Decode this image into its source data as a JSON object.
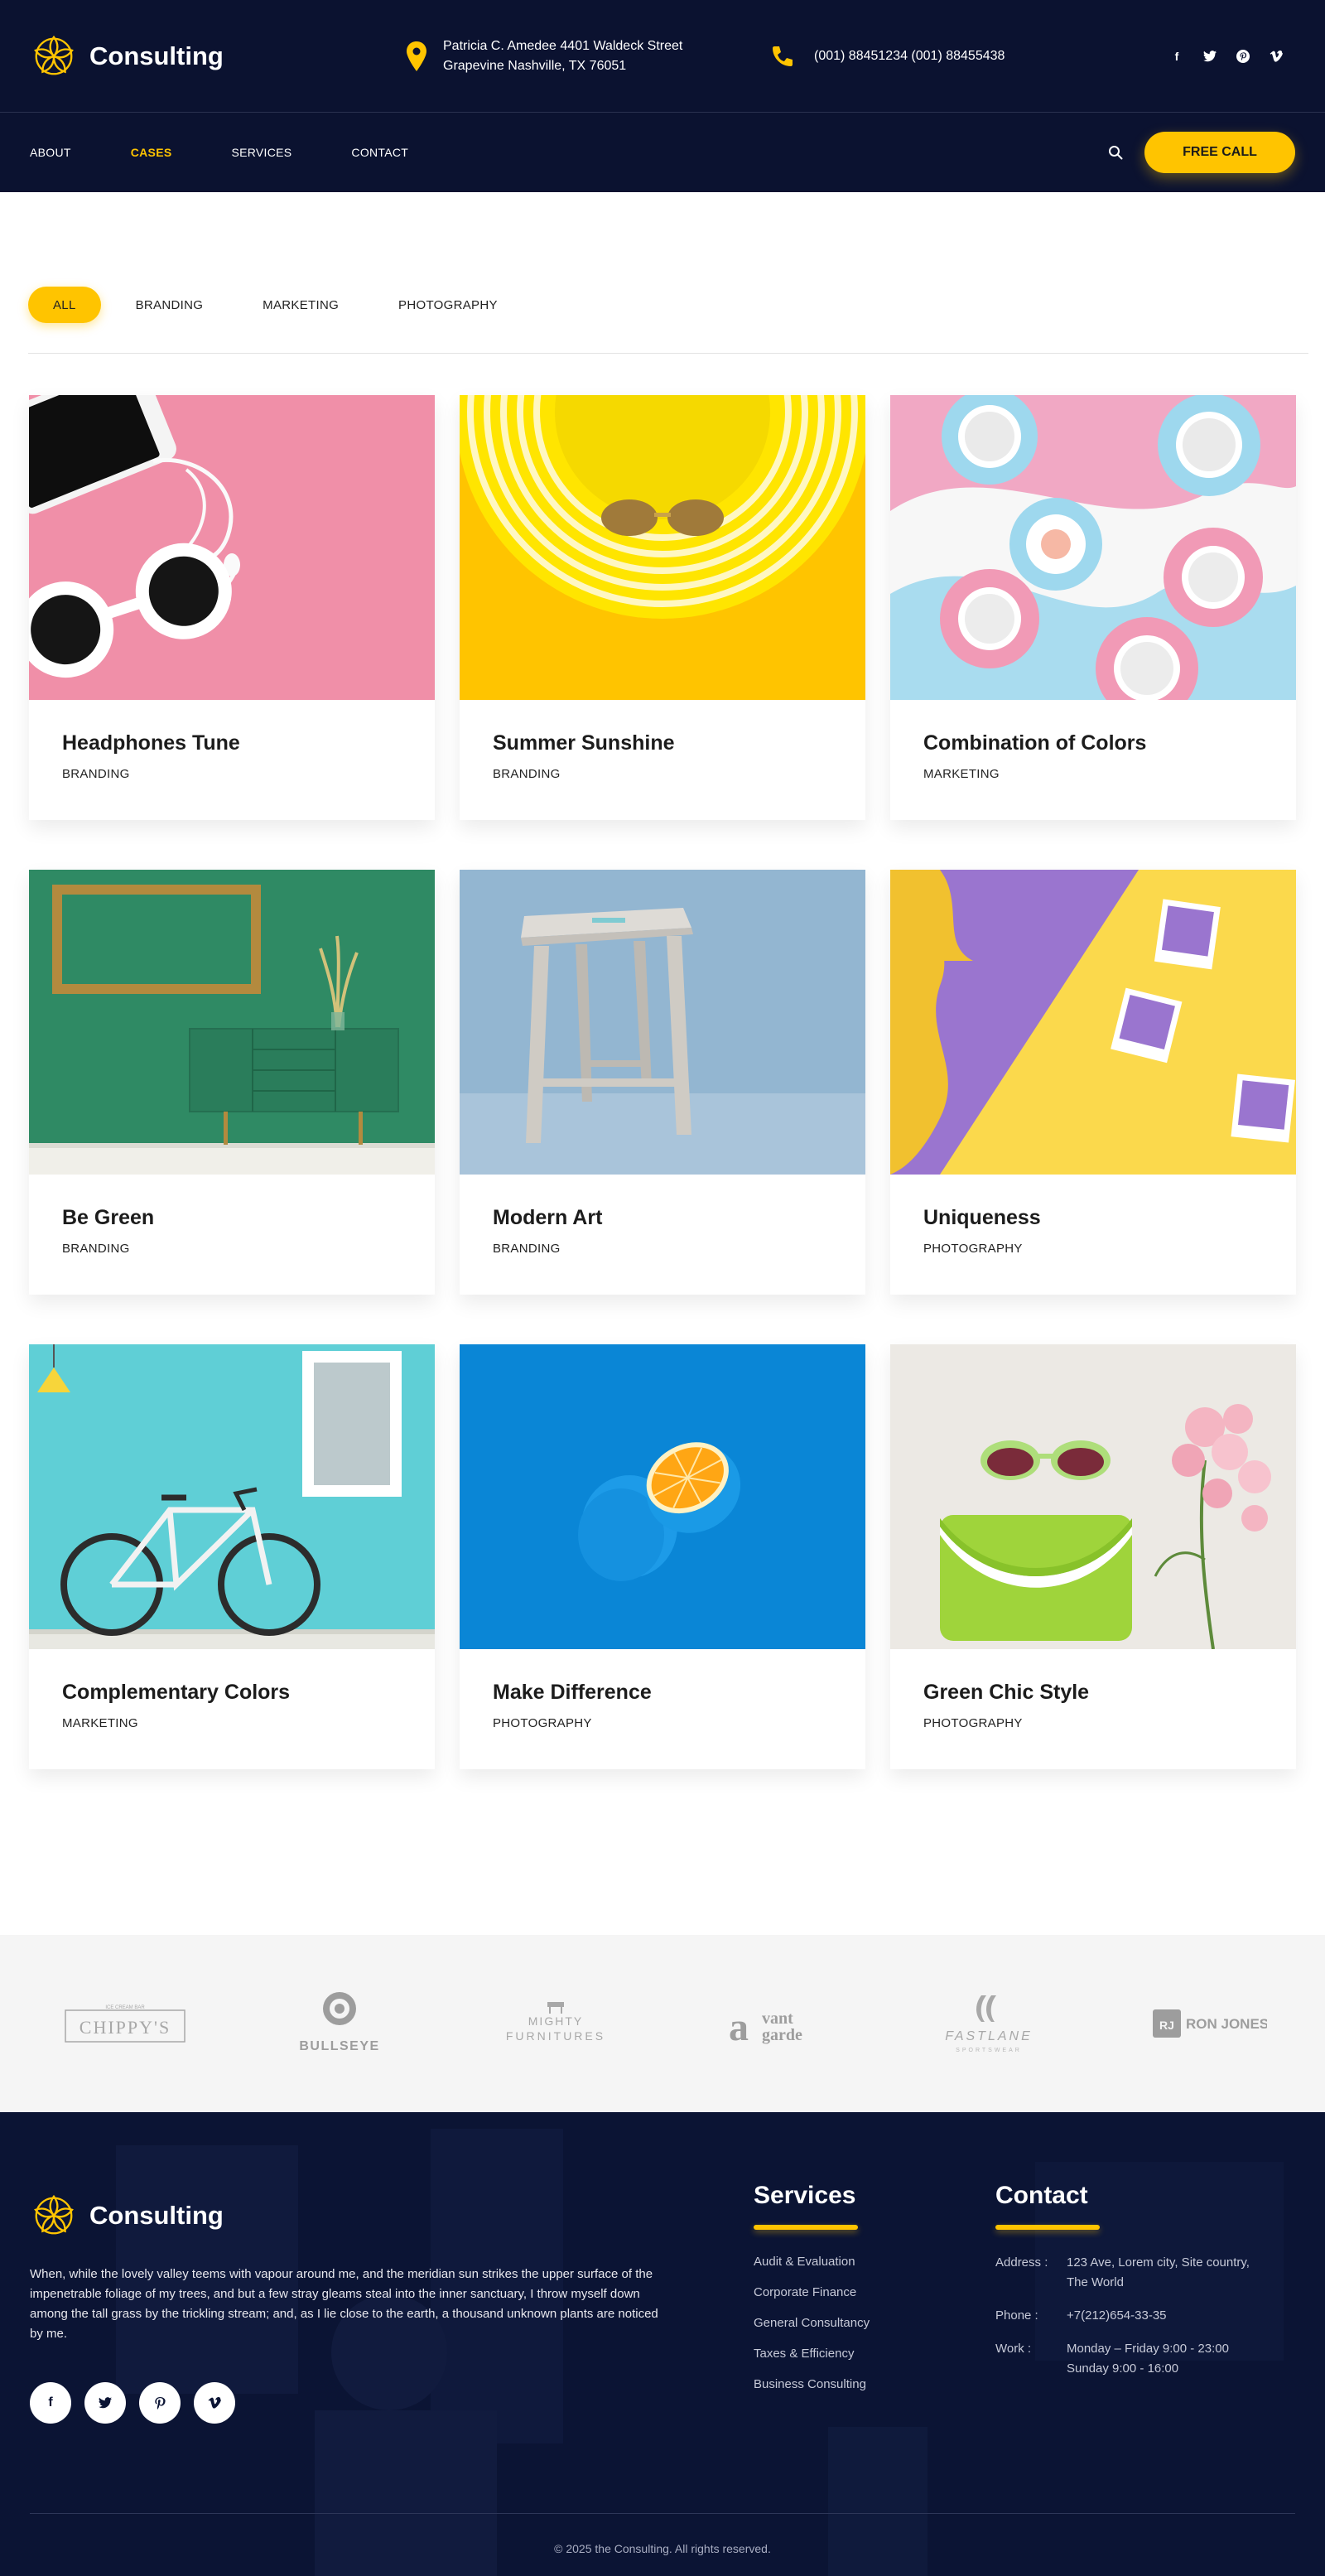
{
  "header": {
    "brand": "Consulting",
    "address_line1": "Patricia C. Amedee 4401 Waldeck Street",
    "address_line2": "Grapevine Nashville, TX 76051",
    "phones": "(001) 88451234  (001) 88455438",
    "social": [
      "facebook",
      "twitter",
      "pinterest",
      "vimeo"
    ],
    "icons": {
      "location": "map-pin-icon",
      "phone": "phone-icon"
    },
    "accent_color": "#ffc400",
    "bg_color": "#0b1230"
  },
  "nav": {
    "items": [
      {
        "label": "ABOUT",
        "active": false
      },
      {
        "label": "CASES",
        "active": true
      },
      {
        "label": "SERVICES",
        "active": false
      },
      {
        "label": "CONTACT",
        "active": false
      }
    ],
    "cta": "FREE CALL"
  },
  "filters": [
    {
      "label": "ALL",
      "active": true
    },
    {
      "label": "BRANDING",
      "active": false
    },
    {
      "label": "MARKETING",
      "active": false
    },
    {
      "label": "PHOTOGRAPHY",
      "active": false
    }
  ],
  "cases": [
    {
      "title": "Headphones Tune",
      "category": "BRANDING",
      "image": "pink-headphones-sunglasses"
    },
    {
      "title": "Summer Sunshine",
      "category": "BRANDING",
      "image": "yellow-hat-sunglasses"
    },
    {
      "title": "Combination of Colors",
      "category": "MARKETING",
      "image": "pastel-cups"
    },
    {
      "title": "Be Green",
      "category": "BRANDING",
      "image": "green-room-cabinet"
    },
    {
      "title": "Modern Art",
      "category": "BRANDING",
      "image": "wooden-stool"
    },
    {
      "title": "Uniqueness",
      "category": "PHOTOGRAPHY",
      "image": "purple-yellow-polaroids"
    },
    {
      "title": "Complementary Colors",
      "category": "MARKETING",
      "image": "bicycle-turquoise-wall"
    },
    {
      "title": "Make Difference",
      "category": "PHOTOGRAPHY",
      "image": "blue-orange"
    },
    {
      "title": "Green Chic Style",
      "category": "PHOTOGRAPHY",
      "image": "green-purse-sunglasses-flowers"
    }
  ],
  "partners": {
    "chippys_small": "ICE CREAM BAR",
    "chippys": "CHIPPY'S",
    "bullseye": "BULLSEYE",
    "mighty_1": "MIGHTY",
    "mighty_2": "FURNITURES",
    "vantgarde_a": "a",
    "vantgarde_1": "vant",
    "vantgarde_2": "garde",
    "fastlane": "FASTLANE",
    "fastlane_sub": "SPORTSWEAR",
    "ronjones_mark": "RJ",
    "ronjones": "RON JONES"
  },
  "footer": {
    "brand": "Consulting",
    "description": "When, while the lovely valley teems with vapour around me, and the meridian sun strikes the upper surface of the impenetrable foliage of my trees, and but a few stray gleams steal into the inner sanctuary, I throw myself down among the tall grass by the trickling stream; and, as I lie close to the earth, a thousand unknown plants are noticed by me.",
    "social": [
      "f",
      "t",
      "p",
      "v"
    ],
    "services_title": "Services",
    "services": [
      "Audit & Evaluation",
      "Corporate Finance",
      "General Consultancy",
      "Taxes & Efficiency",
      "Business Consulting"
    ],
    "contact_title": "Contact",
    "contact": [
      {
        "label": "Address :",
        "value": "123 Ave, Lorem city, Site country, The World"
      },
      {
        "label": "Phone :",
        "value": "+7(212)654-33-35"
      },
      {
        "label": "Work :",
        "value": "Monday – Friday 9:00 - 23:00 Sunday 9:00 - 16:00"
      }
    ],
    "copyright": "© 2025 the Consulting. All rights reserved."
  }
}
